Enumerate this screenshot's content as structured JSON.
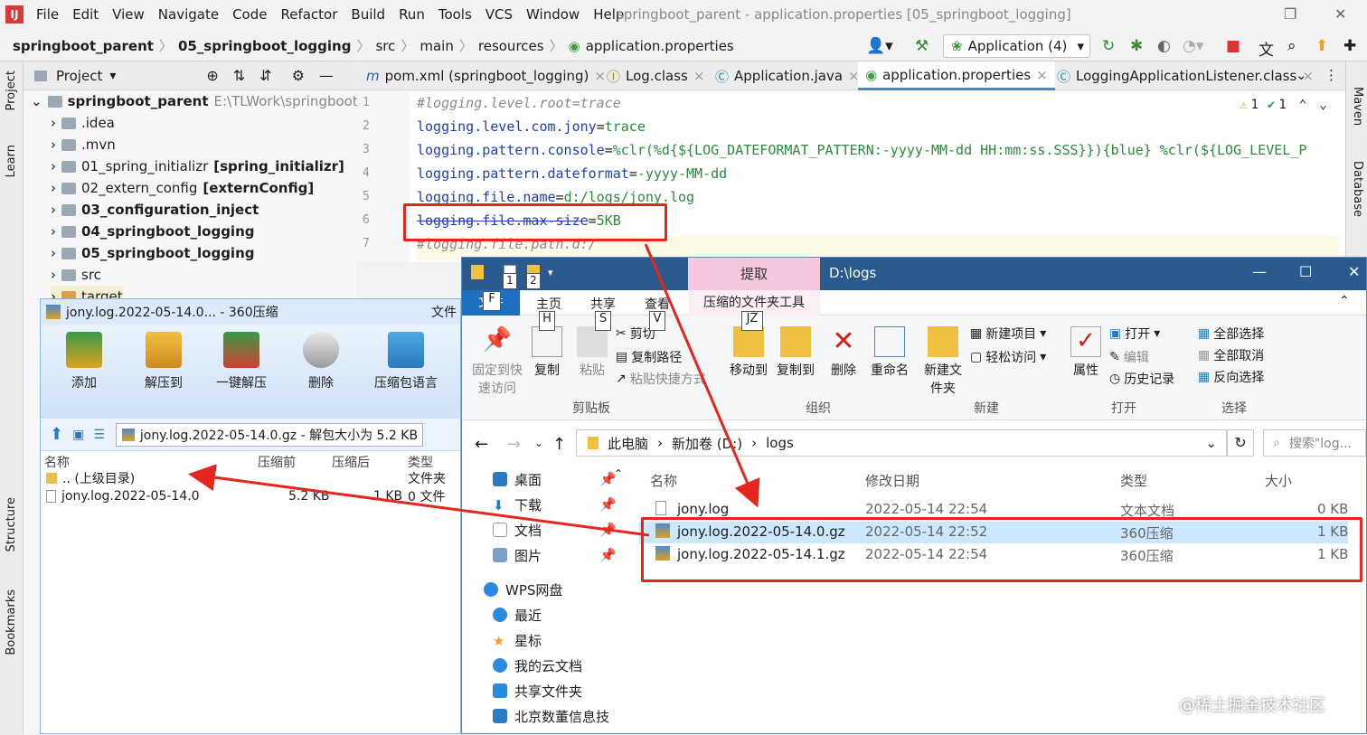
{
  "ide": {
    "menu": [
      "File",
      "Edit",
      "View",
      "Navigate",
      "Code",
      "Refactor",
      "Build",
      "Run",
      "Tools",
      "VCS",
      "Window",
      "Help"
    ],
    "window_title": "springboot_parent - application.properties [05_springboot_logging]",
    "breadcrumb": [
      "springboot_parent",
      "05_springboot_logging",
      "src",
      "main",
      "resources",
      "application.properties"
    ],
    "run_config": "Application (4)",
    "left_tools": [
      "Project",
      "Learn",
      "Structure",
      "Bookmarks"
    ],
    "right_tools": [
      "Maven",
      "Database"
    ],
    "project_header": "Project",
    "tree": [
      {
        "name": "springboot_parent",
        "extra": "E:\\TLWork\\springboot\\spr",
        "bold": true
      },
      {
        "name": ".idea",
        "extra": ""
      },
      {
        "name": ".mvn",
        "extra": ""
      },
      {
        "name": "01_spring_initializr",
        "extra": "[spring_initializr]"
      },
      {
        "name": "02_extern_config",
        "extra": "[externConfig]"
      },
      {
        "name": "03_configuration_inject",
        "extra": "",
        "bold": true
      },
      {
        "name": "04_springboot_logging",
        "extra": "",
        "bold": true
      },
      {
        "name": "05_springboot_logging",
        "extra": "",
        "bold": true
      },
      {
        "name": "src",
        "extra": ""
      },
      {
        "name": "target",
        "extra": ""
      }
    ],
    "tabs": [
      "pom.xml (springboot_logging)",
      "Log.class",
      "Application.java",
      "application.properties",
      "LoggingApplicationListener.class"
    ],
    "inspections": {
      "warnings": "1",
      "ok": "1"
    },
    "code": [
      {
        "n": "1",
        "key": "#logging.level.root=trace",
        "val": "",
        "comment": true
      },
      {
        "n": "2",
        "key": "logging.level.com.jony",
        "val": "trace"
      },
      {
        "n": "3",
        "key": "logging.pattern.console",
        "val": "%clr(%d{${LOG_DATEFORMAT_PATTERN:-yyyy-MM-dd HH:mm:ss.SSS}}){blue} %clr(${LOG_LEVEL_P"
      },
      {
        "n": "4",
        "key": "logging.pattern.dateformat",
        "val": "-yyyy-MM-dd"
      },
      {
        "n": "5",
        "key": "logging.file.name",
        "val": "d:/logs/jony.log"
      },
      {
        "n": "6",
        "key": "logging.file.max-size",
        "val": "5KB",
        "strike": true
      },
      {
        "n": "7",
        "key": "#logging.file.path.d:/",
        "val": "",
        "comment": true
      }
    ]
  },
  "zip": {
    "title": "jony.log.2022-05-14.0... - 360压缩",
    "title_right": "文件",
    "tools": [
      "添加",
      "解压到",
      "一键解压",
      "删除",
      "压缩包语言"
    ],
    "address": "jony.log.2022-05-14.0.gz - 解包大小为 5.2 KB",
    "columns": [
      "名称",
      "压缩前",
      "压缩后",
      "类型"
    ],
    "rows": [
      {
        "name": ".. (上级目录)",
        "before": "",
        "after": "",
        "type": "文件夹"
      },
      {
        "name": "jony.log.2022-05-14.0",
        "before": "5.2 KB",
        "after": "1 KB",
        "type": "0 文件"
      }
    ]
  },
  "explorer": {
    "title": "D:\\logs",
    "context_tab": "提取",
    "context_tool": "压缩的文件夹工具",
    "tabs": [
      "文件",
      "主页",
      "共享",
      "查看"
    ],
    "keytips": [
      "F",
      "H",
      "S",
      "V",
      "JZ",
      "1",
      "2"
    ],
    "ribbon": {
      "pin": "固定到快速访问",
      "copy": "复制",
      "paste": "粘贴",
      "cut": "剪切",
      "copy_path": "复制路径",
      "paste_shortcut": "粘贴快捷方式",
      "move_to": "移动到",
      "copy_to": "复制到",
      "delete": "删除",
      "rename": "重命名",
      "new_folder": "新建文件夹",
      "new_item": "新建项目",
      "easy_access": "轻松访问",
      "properties": "属性",
      "open": "打开",
      "edit": "编辑",
      "history": "历史记录",
      "select_all": "全部选择",
      "select_none": "全部取消",
      "invert": "反向选择",
      "groups": [
        "剪贴板",
        "组织",
        "新建",
        "打开",
        "选择"
      ]
    },
    "path": [
      "此电脑",
      "新加卷 (D:)",
      "logs"
    ],
    "search_placeholder": "搜索\"log...",
    "nav": [
      "桌面",
      "下载",
      "文档",
      "图片",
      "WPS网盘",
      "最近",
      "星标",
      "我的云文档",
      "共享文件夹",
      "北京数董信息技"
    ],
    "columns": [
      "名称",
      "修改日期",
      "类型",
      "大小"
    ],
    "files": [
      {
        "name": "jony.log",
        "date": "2022-05-14 22:54",
        "type": "文本文档",
        "size": "0 KB"
      },
      {
        "name": "jony.log.2022-05-14.0.gz",
        "date": "2022-05-14 22:52",
        "type": "360压缩",
        "size": "1 KB"
      },
      {
        "name": "jony.log.2022-05-14.1.gz",
        "date": "2022-05-14 22:54",
        "type": "360压缩",
        "size": "1 KB"
      }
    ]
  },
  "watermark": "@稀土掘金技术社区",
  "colors": {
    "annotation_red": "#e5261f",
    "accent_blue": "#4a88c7",
    "selection": "#cce8ff"
  }
}
